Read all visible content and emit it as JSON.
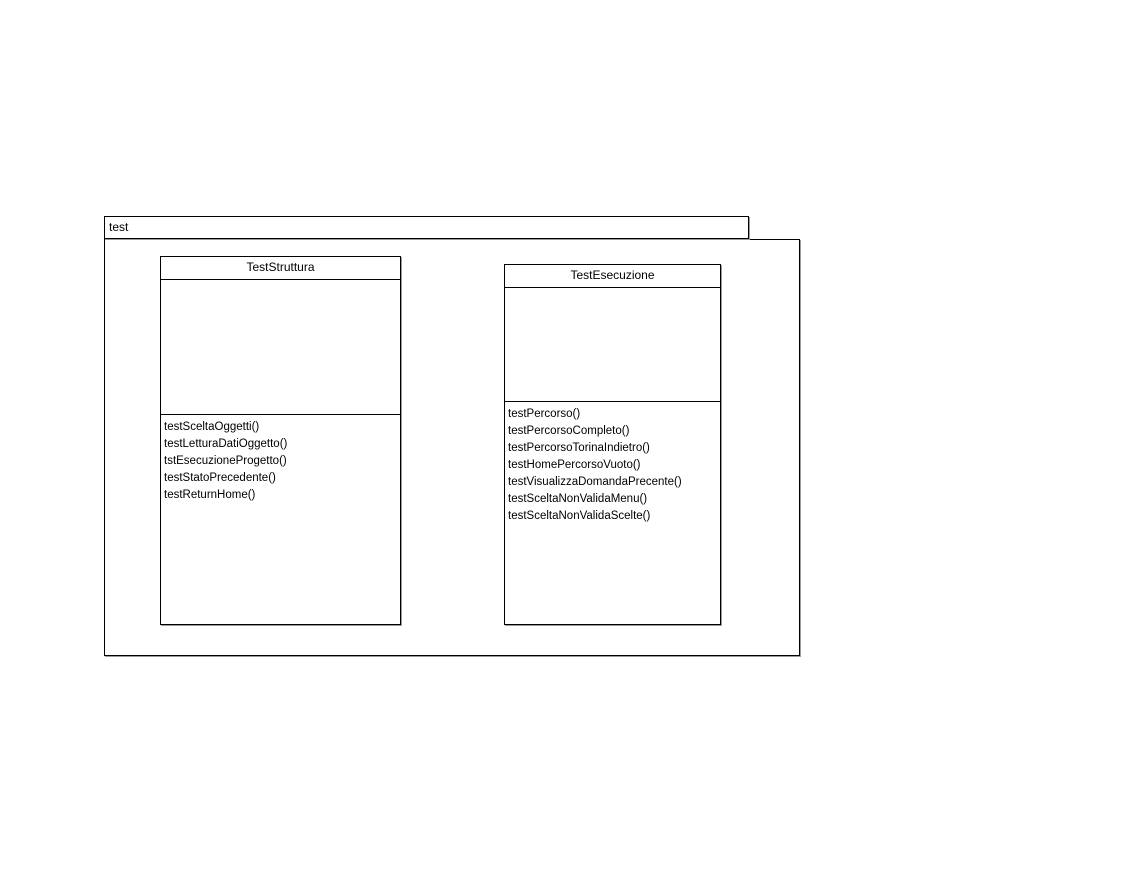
{
  "package": {
    "name": "test"
  },
  "classes": [
    {
      "name": "TestStruttura",
      "attributes": [],
      "operations": [
        "testSceltaOggetti()",
        "testLetturaDatiOggetto()",
        "tstEsecuzioneProgetto()",
        "testStatoPrecedente()",
        "testReturnHome()"
      ]
    },
    {
      "name": "TestEsecuzione",
      "attributes": [],
      "operations": [
        "testPercorso()",
        "testPercorsoCompleto()",
        "testPercorsoTorinaIndietro()",
        "testHomePercorsoVuoto()",
        "testVisualizzaDomandaPrecente()",
        "testSceltaNonValidaMenu()",
        "testSceltaNonValidaScelte()"
      ]
    }
  ]
}
